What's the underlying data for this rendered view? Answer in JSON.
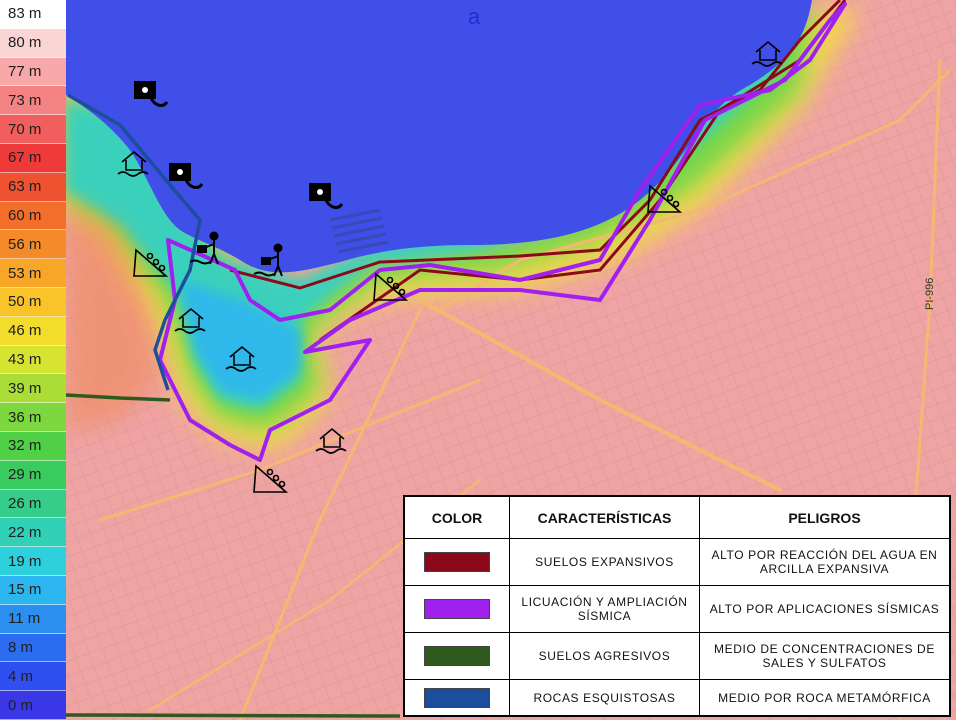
{
  "elevation_scale": {
    "items": [
      {
        "label": "83 m",
        "color": "#ffffff"
      },
      {
        "label": "80 m",
        "color": "#fbd4d4"
      },
      {
        "label": "77 m",
        "color": "#f8a8a8"
      },
      {
        "label": "73 m",
        "color": "#f48484"
      },
      {
        "label": "70 m",
        "color": "#f05e5e"
      },
      {
        "label": "67 m",
        "color": "#ef3a3a"
      },
      {
        "label": "63 m",
        "color": "#ef5230"
      },
      {
        "label": "60 m",
        "color": "#f26e2a"
      },
      {
        "label": "56 m",
        "color": "#f58a28"
      },
      {
        "label": "53 m",
        "color": "#f7a628"
      },
      {
        "label": "50 m",
        "color": "#f8c42a"
      },
      {
        "label": "46 m",
        "color": "#f2dc2c"
      },
      {
        "label": "43 m",
        "color": "#d6e431"
      },
      {
        "label": "39 m",
        "color": "#aade36"
      },
      {
        "label": "36 m",
        "color": "#7cd83e"
      },
      {
        "label": "32 m",
        "color": "#4fd046"
      },
      {
        "label": "29 m",
        "color": "#3acb5e"
      },
      {
        "label": "26 m",
        "color": "#36cc8a"
      },
      {
        "label": "22 m",
        "color": "#32d0b6"
      },
      {
        "label": "19 m",
        "color": "#2ed0de"
      },
      {
        "label": "15 m",
        "color": "#2cb6f0"
      },
      {
        "label": "11 m",
        "color": "#2c8ff0"
      },
      {
        "label": "8 m",
        "color": "#2c6cf0"
      },
      {
        "label": "4 m",
        "color": "#2f4ff0"
      },
      {
        "label": "0 m",
        "color": "#3a38e6"
      }
    ]
  },
  "map": {
    "road_label": "PI-996",
    "water_label": "a",
    "hazard_icons": [
      "house-flood-icon",
      "landslide-icon",
      "sewer-pipe-icon",
      "person-dumping-icon"
    ],
    "zone_colors": {
      "expansive": "#8b0a1a",
      "liquefaction": "#a020f0",
      "aggressive": "#2f5a1e",
      "schist": "#1c4e9c"
    }
  },
  "legend": {
    "headers": {
      "color": "COLOR",
      "characteristics": "CARACTERÍSTICAS",
      "hazards": "PELIGROS"
    },
    "rows": [
      {
        "color": "#8b0a1a",
        "characteristic": "SUELOS EXPANSIVOS",
        "hazard": "ALTO POR REACCIÓN DEL AGUA EN ARCILLA EXPANSIVA"
      },
      {
        "color": "#a020f0",
        "characteristic": "LICUACIÓN Y AMPLIACIÓN SÍSMICA",
        "hazard": "ALTO POR APLICACIONES SÍSMICAS"
      },
      {
        "color": "#2f5a1e",
        "characteristic": "SUELOS AGRESIVOS",
        "hazard": "MEDIO DE CONCENTRACIONES DE SALES Y SULFATOS"
      },
      {
        "color": "#1c4e9c",
        "characteristic": "ROCAS ESQUISTOSAS",
        "hazard": "MEDIO POR ROCA METAMÓRFICA"
      }
    ]
  }
}
